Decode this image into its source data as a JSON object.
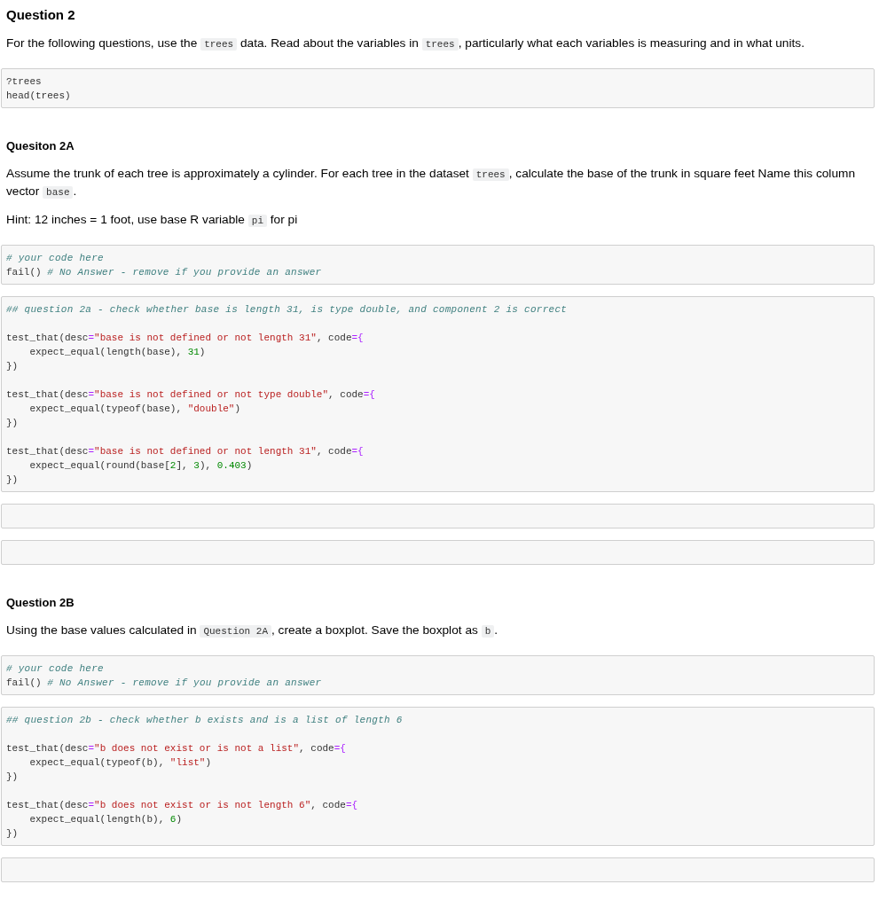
{
  "cells": [
    {
      "kind": "title",
      "text": "Question 2"
    },
    {
      "kind": "paragraph",
      "parts": [
        {
          "kind": "text",
          "text": "For the following questions, use the "
        },
        {
          "kind": "code",
          "text": "trees"
        },
        {
          "kind": "text",
          "text": " data. Read about the variables in "
        },
        {
          "kind": "code",
          "text": "trees"
        },
        {
          "kind": "text",
          "text": ", particularly what each variables is measuring and in what units."
        }
      ]
    },
    {
      "kind": "code",
      "blocks": [
        [
          [
            {
              "kind": "plain",
              "text": "?trees"
            }
          ],
          [
            {
              "kind": "plain",
              "text": "head(trees)"
            }
          ]
        ]
      ]
    },
    {
      "kind": "heading",
      "text": "Quesiton 2A"
    },
    {
      "kind": "paragraph",
      "parts": [
        {
          "kind": "text",
          "text": "Assume the trunk of each tree is approximately a cylinder. For each tree in the dataset "
        },
        {
          "kind": "code",
          "text": "trees"
        },
        {
          "kind": "text",
          "text": ", calculate the base of the trunk in square feet Name this column vector "
        },
        {
          "kind": "code",
          "text": "base"
        },
        {
          "kind": "text",
          "text": "."
        }
      ]
    },
    {
      "kind": "paragraph",
      "parts": [
        {
          "kind": "text",
          "text": "Hint: 12 inches = 1 foot, use base R variable "
        },
        {
          "kind": "code",
          "text": "pi"
        },
        {
          "kind": "text",
          "text": " for pi"
        }
      ]
    },
    {
      "kind": "code",
      "blocks": [
        [
          [
            {
              "kind": "comment",
              "text": "# your code here"
            }
          ],
          [
            {
              "kind": "plain",
              "text": "fail() "
            },
            {
              "kind": "comment",
              "text": "# No Answer - remove if you provide an answer"
            }
          ]
        ]
      ]
    },
    {
      "kind": "code",
      "blocks": [
        [
          [
            {
              "kind": "comment",
              "text": "## question 2a - check whether base is length 31, is type double, and component 2 is correct"
            }
          ]
        ],
        [
          [
            {
              "kind": "plain",
              "text": "test_that(desc"
            },
            {
              "kind": "operator",
              "text": "="
            },
            {
              "kind": "string",
              "text": "\"base is not defined or not length 31\""
            },
            {
              "kind": "plain",
              "text": ", code"
            },
            {
              "kind": "operator",
              "text": "={"
            }
          ],
          [
            {
              "kind": "plain",
              "text": "    expect_equal(length(base), "
            },
            {
              "kind": "number",
              "text": "31"
            },
            {
              "kind": "plain",
              "text": ")"
            }
          ],
          [
            {
              "kind": "plain",
              "text": "})"
            }
          ]
        ],
        [
          [
            {
              "kind": "plain",
              "text": "test_that(desc"
            },
            {
              "kind": "operator",
              "text": "="
            },
            {
              "kind": "string",
              "text": "\"base is not defined or not type double\""
            },
            {
              "kind": "plain",
              "text": ", code"
            },
            {
              "kind": "operator",
              "text": "={"
            }
          ],
          [
            {
              "kind": "plain",
              "text": "    expect_equal(typeof(base), "
            },
            {
              "kind": "string",
              "text": "\"double\""
            },
            {
              "kind": "plain",
              "text": ")"
            }
          ],
          [
            {
              "kind": "plain",
              "text": "})"
            }
          ]
        ],
        [
          [
            {
              "kind": "plain",
              "text": "test_that(desc"
            },
            {
              "kind": "operator",
              "text": "="
            },
            {
              "kind": "string",
              "text": "\"base is not defined or not length 31\""
            },
            {
              "kind": "plain",
              "text": ", code"
            },
            {
              "kind": "operator",
              "text": "={"
            }
          ],
          [
            {
              "kind": "plain",
              "text": "    expect_equal(round(base["
            },
            {
              "kind": "number",
              "text": "2"
            },
            {
              "kind": "plain",
              "text": "], "
            },
            {
              "kind": "number",
              "text": "3"
            },
            {
              "kind": "plain",
              "text": "), "
            },
            {
              "kind": "number",
              "text": "0.403"
            },
            {
              "kind": "plain",
              "text": ")"
            }
          ],
          [
            {
              "kind": "plain",
              "text": "})"
            }
          ]
        ]
      ]
    },
    {
      "kind": "code"
    },
    {
      "kind": "code"
    },
    {
      "kind": "heading",
      "text": "Question 2B"
    },
    {
      "kind": "paragraph",
      "parts": [
        {
          "kind": "text",
          "text": "Using the base values calculated in "
        },
        {
          "kind": "code",
          "text": "Question 2A"
        },
        {
          "kind": "text",
          "text": ", create a boxplot. Save the boxplot as "
        },
        {
          "kind": "code",
          "text": "b"
        },
        {
          "kind": "text",
          "text": "."
        }
      ]
    },
    {
      "kind": "code",
      "blocks": [
        [
          [
            {
              "kind": "comment",
              "text": "# your code here"
            }
          ],
          [
            {
              "kind": "plain",
              "text": "fail() "
            },
            {
              "kind": "comment",
              "text": "# No Answer - remove if you provide an answer"
            }
          ]
        ]
      ]
    },
    {
      "kind": "code",
      "blocks": [
        [
          [
            {
              "kind": "comment",
              "text": "## question 2b - check whether b exists and is a list of length 6"
            }
          ]
        ],
        [
          [
            {
              "kind": "plain",
              "text": "test_that(desc"
            },
            {
              "kind": "operator",
              "text": "="
            },
            {
              "kind": "string",
              "text": "\"b does not exist or is not a list\""
            },
            {
              "kind": "plain",
              "text": ", code"
            },
            {
              "kind": "operator",
              "text": "={"
            }
          ],
          [
            {
              "kind": "plain",
              "text": "    expect_equal(typeof(b), "
            },
            {
              "kind": "string",
              "text": "\"list\""
            },
            {
              "kind": "plain",
              "text": ")"
            }
          ],
          [
            {
              "kind": "plain",
              "text": "})"
            }
          ]
        ],
        [
          [
            {
              "kind": "plain",
              "text": "test_that(desc"
            },
            {
              "kind": "operator",
              "text": "="
            },
            {
              "kind": "string",
              "text": "\"b does not exist or is not length 6\""
            },
            {
              "kind": "plain",
              "text": ", code"
            },
            {
              "kind": "operator",
              "text": "={"
            }
          ],
          [
            {
              "kind": "plain",
              "text": "    expect_equal(length(b), "
            },
            {
              "kind": "number",
              "text": "6"
            },
            {
              "kind": "plain",
              "text": ")"
            }
          ],
          [
            {
              "kind": "plain",
              "text": "})"
            }
          ]
        ]
      ]
    },
    {
      "kind": "code"
    }
  ]
}
